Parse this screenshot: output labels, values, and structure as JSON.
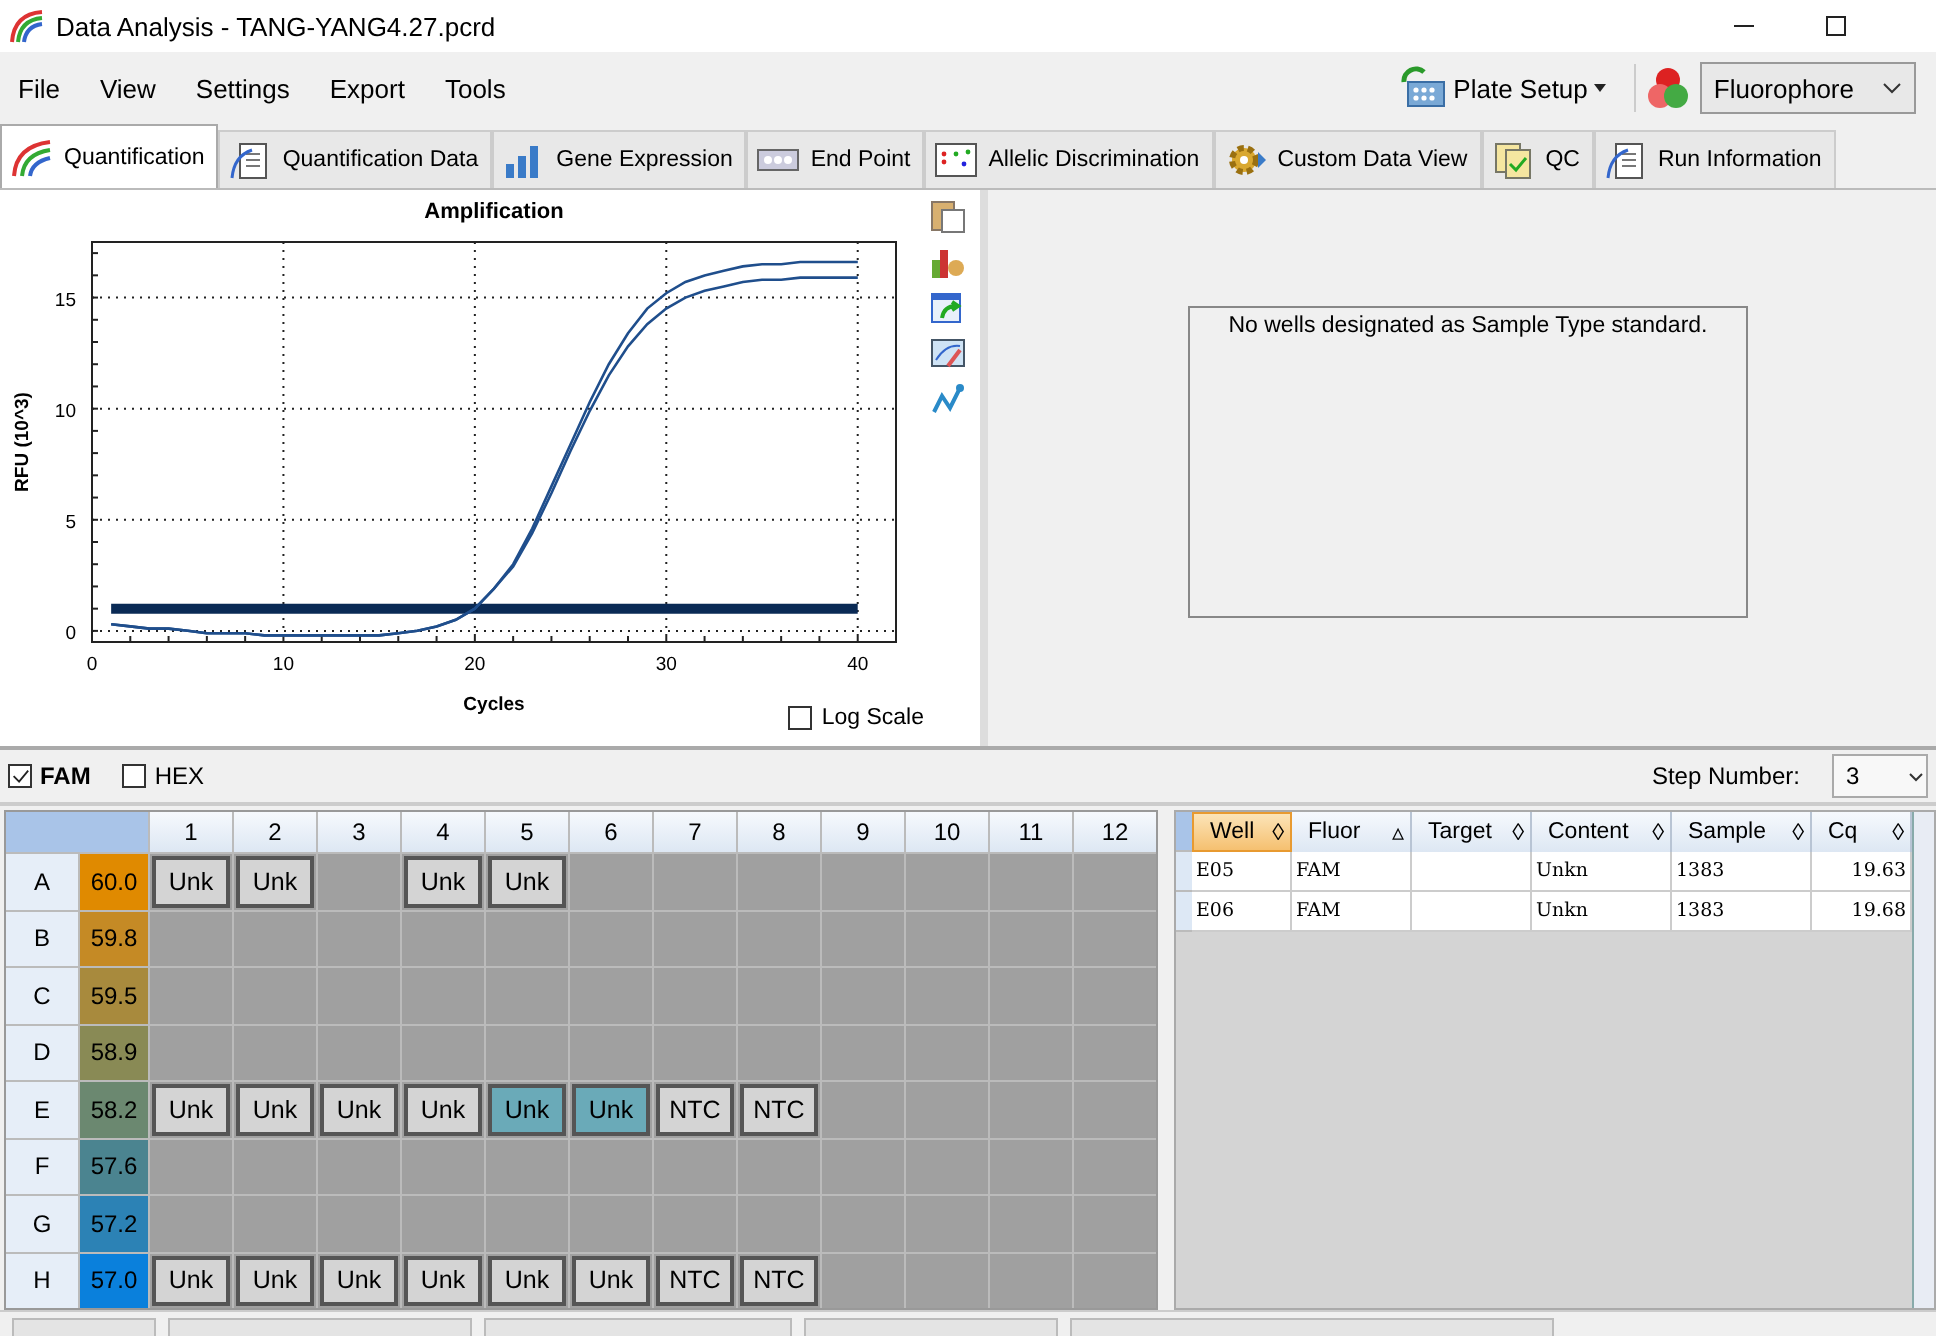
{
  "window": {
    "title": "Data Analysis - TANG-YANG4.27.pcrd"
  },
  "menu": [
    "File",
    "View",
    "Settings",
    "Export",
    "Tools"
  ],
  "toolbar": {
    "plate_setup": "Plate Setup",
    "fluorophore": "Fluorophore"
  },
  "tabs": [
    {
      "label": "Quantification",
      "selected": true
    },
    {
      "label": "Quantification Data",
      "selected": false
    },
    {
      "label": "Gene Expression",
      "selected": false
    },
    {
      "label": "End Point",
      "selected": false
    },
    {
      "label": "Allelic Discrimination",
      "selected": false
    },
    {
      "label": "Custom Data View",
      "selected": false
    },
    {
      "label": "QC",
      "selected": false
    },
    {
      "label": "Run Information",
      "selected": false
    }
  ],
  "amplification": {
    "log_scale": {
      "label": "Log Scale",
      "checked": false
    },
    "chart_data": {
      "type": "line",
      "title": "Amplification",
      "xlabel": "Cycles",
      "ylabel": "RFU (10^3)",
      "x": [
        1,
        2,
        3,
        4,
        5,
        6,
        7,
        8,
        9,
        10,
        11,
        12,
        13,
        14,
        15,
        16,
        17,
        18,
        19,
        20,
        21,
        22,
        23,
        24,
        25,
        26,
        27,
        28,
        29,
        30,
        31,
        32,
        33,
        34,
        35,
        36,
        37,
        38,
        39,
        40
      ],
      "series": [
        {
          "color": "#1f4e8c",
          "values": [
            0.3,
            0.2,
            0.1,
            0.1,
            0,
            -0.1,
            -0.1,
            -0.1,
            -0.2,
            -0.2,
            -0.2,
            -0.2,
            -0.2,
            -0.2,
            -0.2,
            -0.1,
            0,
            0.2,
            0.5,
            1.0,
            1.9,
            3.0,
            4.6,
            6.5,
            8.4,
            10.3,
            12.0,
            13.4,
            14.5,
            15.2,
            15.7,
            16.0,
            16.2,
            16.4,
            16.5,
            16.5,
            16.6,
            16.6,
            16.6,
            16.6
          ]
        },
        {
          "color": "#1f4e8c",
          "values": [
            0.3,
            0.2,
            0.1,
            0.1,
            0,
            -0.1,
            -0.1,
            -0.1,
            -0.2,
            -0.2,
            -0.2,
            -0.2,
            -0.2,
            -0.2,
            -0.2,
            -0.1,
            0,
            0.2,
            0.5,
            1.0,
            1.9,
            2.9,
            4.4,
            6.2,
            8.1,
            9.9,
            11.5,
            12.8,
            13.8,
            14.5,
            15.0,
            15.3,
            15.5,
            15.7,
            15.8,
            15.8,
            15.9,
            15.9,
            15.9,
            15.9
          ]
        }
      ],
      "xlim": [
        0,
        42
      ],
      "ylim": [
        -0.5,
        17.5
      ],
      "xticks": [
        0,
        10,
        20,
        30,
        40
      ],
      "yticks": [
        0,
        5,
        10,
        15
      ],
      "grid": true,
      "ref_lines": [
        {
          "axis": "y",
          "value": 1.0,
          "color": "#0a2a55"
        }
      ]
    }
  },
  "standard_curve": {
    "message": "No wells designated as Sample Type standard."
  },
  "fluors": [
    {
      "label": "FAM",
      "checked": true
    },
    {
      "label": "HEX",
      "checked": false
    }
  ],
  "step_number": {
    "label": "Step Number:",
    "value": "3"
  },
  "plate": {
    "columns": [
      "1",
      "2",
      "3",
      "4",
      "5",
      "6",
      "7",
      "8",
      "9",
      "10",
      "11",
      "12"
    ],
    "rows": [
      {
        "label": "A",
        "temperature": "60.0",
        "color": "#e08a00",
        "wells": [
          {
            "kind": "sample",
            "content": "Unk",
            "selected": false
          },
          {
            "kind": "sample",
            "content": "Unk",
            "selected": false
          },
          {
            "kind": "empty"
          },
          {
            "kind": "sample",
            "content": "Unk",
            "selected": false
          },
          {
            "kind": "sample",
            "content": "Unk",
            "selected": false
          },
          {
            "kind": "empty"
          },
          {
            "kind": "empty"
          },
          {
            "kind": "empty"
          },
          {
            "kind": "empty"
          },
          {
            "kind": "empty"
          },
          {
            "kind": "empty"
          },
          {
            "kind": "empty"
          }
        ]
      },
      {
        "label": "B",
        "temperature": "59.8",
        "color": "#c58a25",
        "wells": [
          {
            "kind": "empty"
          },
          {
            "kind": "empty"
          },
          {
            "kind": "empty"
          },
          {
            "kind": "empty"
          },
          {
            "kind": "empty"
          },
          {
            "kind": "empty"
          },
          {
            "kind": "empty"
          },
          {
            "kind": "empty"
          },
          {
            "kind": "empty"
          },
          {
            "kind": "empty"
          },
          {
            "kind": "empty"
          },
          {
            "kind": "empty"
          }
        ]
      },
      {
        "label": "C",
        "temperature": "59.5",
        "color": "#a88a3d",
        "wells": [
          {
            "kind": "empty"
          },
          {
            "kind": "empty"
          },
          {
            "kind": "empty"
          },
          {
            "kind": "empty"
          },
          {
            "kind": "empty"
          },
          {
            "kind": "empty"
          },
          {
            "kind": "empty"
          },
          {
            "kind": "empty"
          },
          {
            "kind": "empty"
          },
          {
            "kind": "empty"
          },
          {
            "kind": "empty"
          },
          {
            "kind": "empty"
          }
        ]
      },
      {
        "label": "D",
        "temperature": "58.9",
        "color": "#898a55",
        "wells": [
          {
            "kind": "empty"
          },
          {
            "kind": "empty"
          },
          {
            "kind": "empty"
          },
          {
            "kind": "empty"
          },
          {
            "kind": "empty"
          },
          {
            "kind": "empty"
          },
          {
            "kind": "empty"
          },
          {
            "kind": "empty"
          },
          {
            "kind": "empty"
          },
          {
            "kind": "empty"
          },
          {
            "kind": "empty"
          },
          {
            "kind": "empty"
          }
        ]
      },
      {
        "label": "E",
        "temperature": "58.2",
        "color": "#6b8870",
        "wells": [
          {
            "kind": "sample",
            "content": "Unk",
            "selected": false
          },
          {
            "kind": "sample",
            "content": "Unk",
            "selected": false
          },
          {
            "kind": "sample",
            "content": "Unk",
            "selected": false
          },
          {
            "kind": "sample",
            "content": "Unk",
            "selected": false
          },
          {
            "kind": "sample",
            "content": "Unk",
            "selected": true
          },
          {
            "kind": "sample",
            "content": "Unk",
            "selected": true
          },
          {
            "kind": "sample",
            "content": "NTC",
            "selected": false
          },
          {
            "kind": "sample",
            "content": "NTC",
            "selected": false
          },
          {
            "kind": "empty"
          },
          {
            "kind": "empty"
          },
          {
            "kind": "empty"
          },
          {
            "kind": "empty"
          }
        ]
      },
      {
        "label": "F",
        "temperature": "57.6",
        "color": "#4b8490",
        "wells": [
          {
            "kind": "empty"
          },
          {
            "kind": "empty"
          },
          {
            "kind": "empty"
          },
          {
            "kind": "empty"
          },
          {
            "kind": "empty"
          },
          {
            "kind": "empty"
          },
          {
            "kind": "empty"
          },
          {
            "kind": "empty"
          },
          {
            "kind": "empty"
          },
          {
            "kind": "empty"
          },
          {
            "kind": "empty"
          },
          {
            "kind": "empty"
          }
        ]
      },
      {
        "label": "G",
        "temperature": "57.2",
        "color": "#2c82b5",
        "wells": [
          {
            "kind": "empty"
          },
          {
            "kind": "empty"
          },
          {
            "kind": "empty"
          },
          {
            "kind": "empty"
          },
          {
            "kind": "empty"
          },
          {
            "kind": "empty"
          },
          {
            "kind": "empty"
          },
          {
            "kind": "empty"
          },
          {
            "kind": "empty"
          },
          {
            "kind": "empty"
          },
          {
            "kind": "empty"
          },
          {
            "kind": "empty"
          }
        ]
      },
      {
        "label": "H",
        "temperature": "57.0",
        "color": "#0a80dc",
        "wells": [
          {
            "kind": "sample",
            "content": "Unk",
            "selected": false
          },
          {
            "kind": "sample",
            "content": "Unk",
            "selected": false
          },
          {
            "kind": "sample",
            "content": "Unk",
            "selected": false
          },
          {
            "kind": "sample",
            "content": "Unk",
            "selected": false
          },
          {
            "kind": "sample",
            "content": "Unk",
            "selected": false
          },
          {
            "kind": "sample",
            "content": "Unk",
            "selected": false
          },
          {
            "kind": "sample",
            "content": "NTC",
            "selected": false
          },
          {
            "kind": "sample",
            "content": "NTC",
            "selected": false
          },
          {
            "kind": "empty"
          },
          {
            "kind": "empty"
          },
          {
            "kind": "empty"
          },
          {
            "kind": "empty"
          }
        ]
      }
    ]
  },
  "results": {
    "columns": [
      {
        "label": "Well",
        "sort": "◊",
        "selected": true
      },
      {
        "label": "Fluor",
        "sort": "▵",
        "selected": false
      },
      {
        "label": "Target",
        "sort": "◊",
        "selected": false
      },
      {
        "label": "Content",
        "sort": "◊",
        "selected": false
      },
      {
        "label": "Sample",
        "sort": "◊",
        "selected": false
      },
      {
        "label": "Cq",
        "sort": "◊",
        "selected": false
      }
    ],
    "rows": [
      [
        "E05",
        "FAM",
        "",
        "Unkn",
        "1383",
        "19.63"
      ],
      [
        "E06",
        "FAM",
        "",
        "Unkn",
        "1383",
        "19.68"
      ]
    ]
  }
}
